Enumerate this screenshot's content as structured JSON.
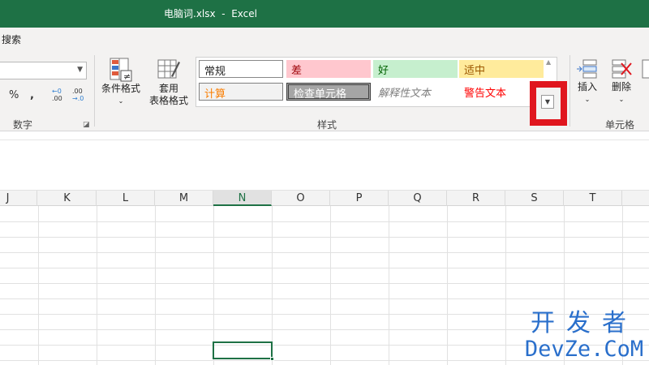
{
  "window": {
    "title": "电脑词.xlsx  -  Excel"
  },
  "ribbon": {
    "search_label": "搜索",
    "number_group": {
      "label": "数字",
      "percent": "%",
      "comma": ",",
      "increase_decimal_top": "←0",
      "increase_decimal_bottom": ".00",
      "decrease_decimal_top": ".00",
      "decrease_decimal_bottom": "→.0"
    },
    "styles_group": {
      "label": "样式",
      "conditional_format": "条件格式",
      "format_as_table_line1": "套用",
      "format_as_table_line2": "表格格式",
      "cell_styles": [
        {
          "label": "常规",
          "bg": "#ffffff",
          "color": "#000000"
        },
        {
          "label": "差",
          "bg": "#ffc7ce",
          "color": "#9c0006"
        },
        {
          "label": "好",
          "bg": "#c6efce",
          "color": "#006100"
        },
        {
          "label": "适中",
          "bg": "#ffeb9c",
          "color": "#9c5700"
        },
        {
          "label": "计算",
          "bg": "#f2f2f2",
          "color": "#fa7d00"
        },
        {
          "label": "检查单元格",
          "bg": "#a5a5a5",
          "color": "#ffffff"
        },
        {
          "label": "解释性文本",
          "bg": "#ffffff",
          "color": "#7f7f7f"
        },
        {
          "label": "警告文本",
          "bg": "#ffffff",
          "color": "#ff0000"
        }
      ]
    },
    "cells_group": {
      "label": "单元格",
      "insert": "插入",
      "delete": "删除"
    }
  },
  "grid": {
    "columns": [
      "J",
      "K",
      "L",
      "M",
      "N",
      "O",
      "P",
      "Q",
      "R",
      "S",
      "T"
    ],
    "active_column": "N"
  },
  "watermark": {
    "cn": "开发者",
    "en": "DevZe.CoM"
  }
}
